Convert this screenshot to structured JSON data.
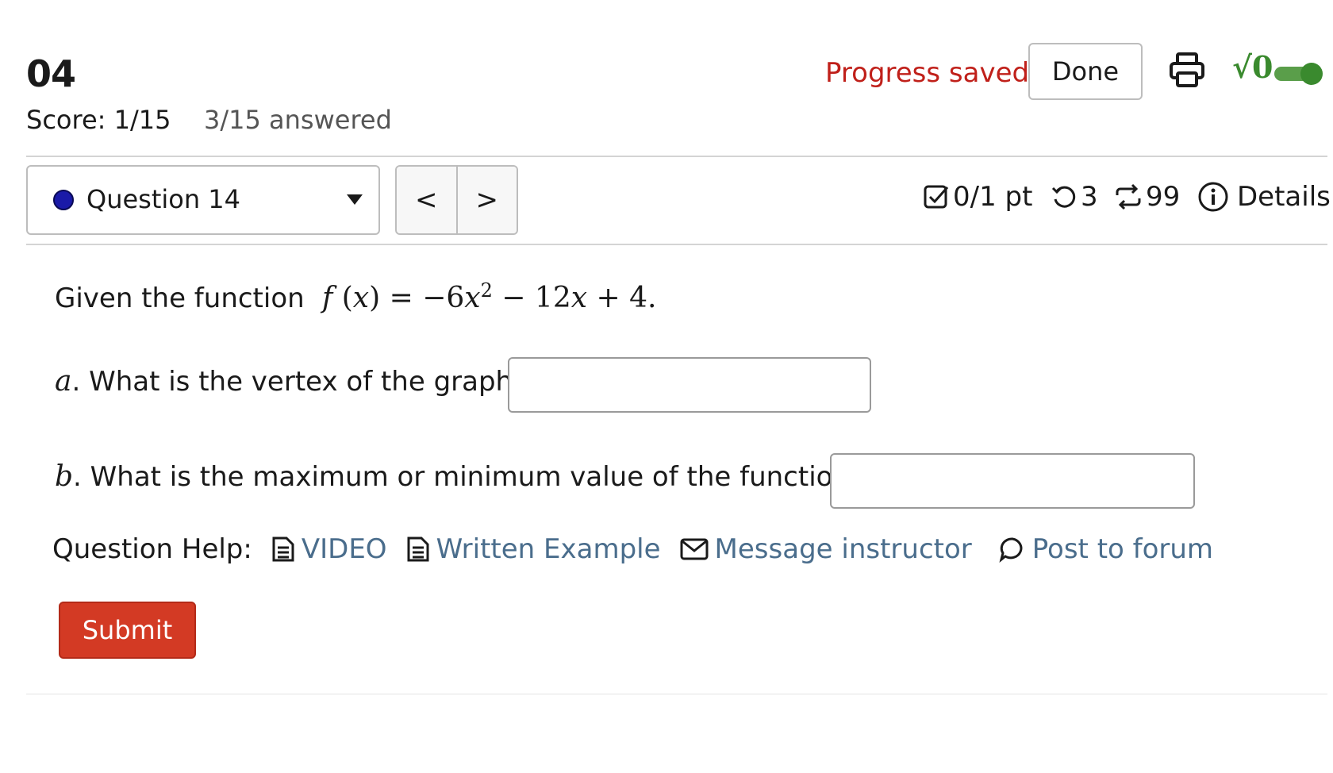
{
  "header": {
    "title": "04",
    "score": "Score: 1/15",
    "answered": "3/15 answered",
    "progress_status": "Progress saved",
    "done_label": "Done",
    "sqrt_label": "√0"
  },
  "question_nav": {
    "selected": "Question 14",
    "prev_label": "<",
    "next_label": ">"
  },
  "meta": {
    "points": "0/1 pt",
    "retries": "3",
    "submissions": "99",
    "details_label": "Details"
  },
  "question": {
    "intro": "Given the function",
    "part_a_letter": "a",
    "part_a_text": ". What is the vertex of the graph?",
    "part_a_value": "",
    "part_b_letter": "b",
    "part_b_text": ". What is the maximum or minimum value of the function?",
    "part_b_value": ""
  },
  "help": {
    "label": "Question Help:",
    "video": "VIDEO",
    "written_example": "Written Example",
    "message_instructor": "Message instructor",
    "post_to_forum": "Post to forum"
  },
  "submit_label": "Submit",
  "colors": {
    "accent_red": "#c0201a",
    "submit_red": "#d33a24",
    "link_blue": "#4a6d8c",
    "toggle_green": "#3a8a2e",
    "question_dot": "#1a1aa8"
  }
}
